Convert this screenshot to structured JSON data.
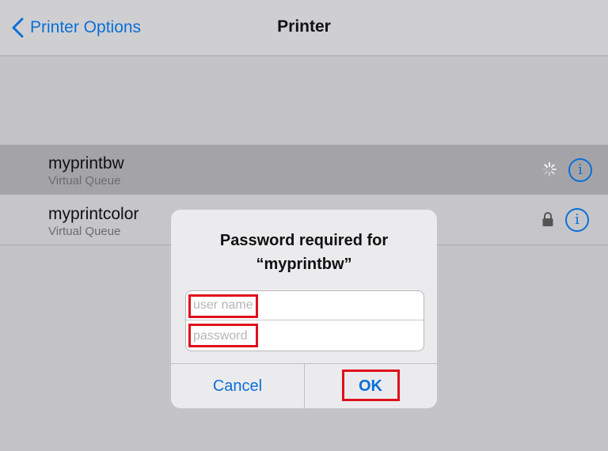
{
  "navbar": {
    "back_label": "Printer Options",
    "title": "Printer"
  },
  "printers": [
    {
      "name": "myprintbw",
      "subtitle": "Virtual Queue",
      "status": "loading"
    },
    {
      "name": "myprintcolor",
      "subtitle": "Virtual Queue",
      "status": "locked"
    }
  ],
  "dialog": {
    "title_line1": "Password required for",
    "title_line2": "“myprintbw”",
    "username_placeholder": "user name",
    "username_value": "",
    "password_placeholder": "password",
    "password_value": "",
    "cancel_label": "Cancel",
    "ok_label": "OK"
  },
  "icons": {
    "back": "chevron-left-icon",
    "info": "info-icon",
    "spinner": "spinner-icon",
    "lock": "lock-icon"
  },
  "colors": {
    "accent": "#0a6fd6",
    "highlight": "#e0101c"
  }
}
